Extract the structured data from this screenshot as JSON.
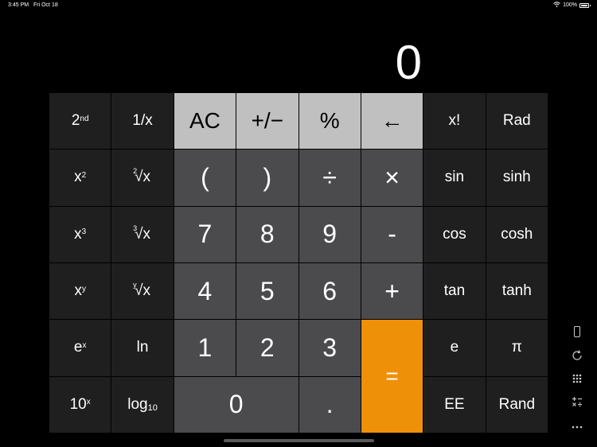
{
  "status": {
    "time": "3:45 PM",
    "date": "Fri Oct 18",
    "battery": "100%"
  },
  "display": {
    "value": "0"
  },
  "keys": {
    "second": "2",
    "second_sup": "nd",
    "reciprocal": "1/x",
    "clear": "AC",
    "negate": "+/−",
    "percent": "%",
    "backspace": "←",
    "factorial": "x!",
    "rad": "Rad",
    "x_sq_base": "x",
    "x_sq_sup": "2",
    "sqrt2_idx": "2",
    "sqrt2_body": "√x",
    "lparen": "(",
    "rparen": ")",
    "divide": "÷",
    "multiply": "×",
    "sin": "sin",
    "sinh": "sinh",
    "x_cube_base": "x",
    "x_cube_sup": "3",
    "sqrt3_idx": "3",
    "sqrt3_body": "√x",
    "d7": "7",
    "d8": "8",
    "d9": "9",
    "minus": "-",
    "cos": "cos",
    "cosh": "cosh",
    "x_y_base": "x",
    "x_y_sup": "y",
    "sqrty_idx": "y",
    "sqrty_body": "√x",
    "d4": "4",
    "d5": "5",
    "d6": "6",
    "plus": "+",
    "tan": "tan",
    "tanh": "tanh",
    "e_x_base": "e",
    "e_x_sup": "x",
    "ln": "ln",
    "d1": "1",
    "d2": "2",
    "d3": "3",
    "equals": "=",
    "e": "e",
    "pi": "π",
    "ten_x_base": "10",
    "ten_x_sup": "x",
    "log_base": "log",
    "log_sub": "10",
    "d0": "0",
    "decimal": ".",
    "ee": "EE",
    "rand": "Rand"
  },
  "side_icons": [
    "phone-icon",
    "rotate-icon",
    "grid-icon",
    "calculator-ops-icon",
    "more-icon"
  ],
  "colors": {
    "orange": "#ef9009",
    "light_key": "#c0c0c0",
    "mid_key": "#4b4b4d",
    "dark_key": "#1f1f1f"
  }
}
